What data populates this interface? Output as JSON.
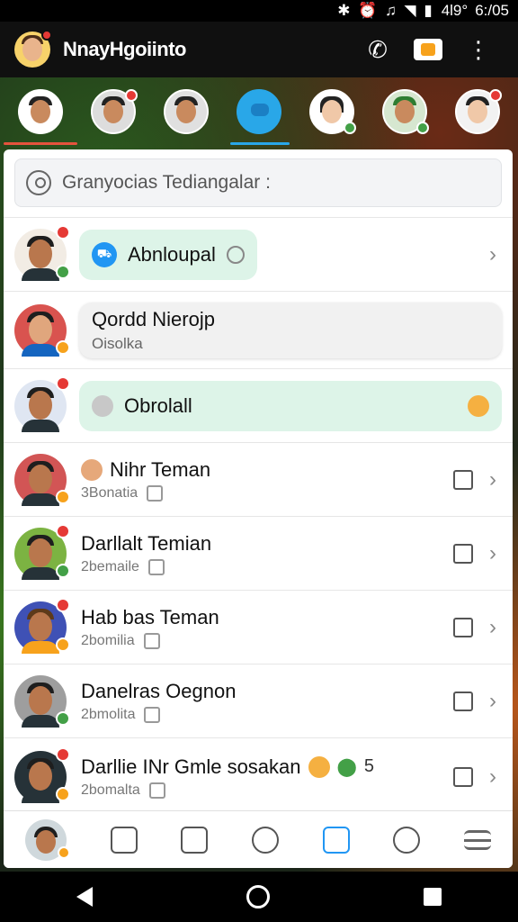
{
  "status_bar": {
    "icons": "✱ ⏰ ♫ ◥ ▮",
    "text": "4l9°",
    "time": "6:/05"
  },
  "header": {
    "title": "NnayHgoiinto"
  },
  "search": {
    "text": "Granyocias Tediangalar :"
  },
  "rows": [
    {
      "bubble": "Abnloupal"
    },
    {
      "title": "Qordd Nierojp",
      "sub": "Oisolka"
    },
    {
      "bubble": "Obrolall"
    },
    {
      "name": "Nihr Teman",
      "sub": "3Bonatia"
    },
    {
      "name": "Darllalt Temian",
      "sub": "2bemaile"
    },
    {
      "name": "Hab bas Teman",
      "sub": "2bomilia"
    },
    {
      "name": "Danelras Oegnon",
      "sub": "2bmolita"
    },
    {
      "name": "Darllie INr Gmle sosakan",
      "sub": "2bomalta",
      "extra_num": "5"
    }
  ],
  "colors": {
    "accent_green": "#43a047",
    "accent_blue": "#29a7e8",
    "badge_red": "#e53935",
    "badge_orange": "#f7a21c"
  }
}
